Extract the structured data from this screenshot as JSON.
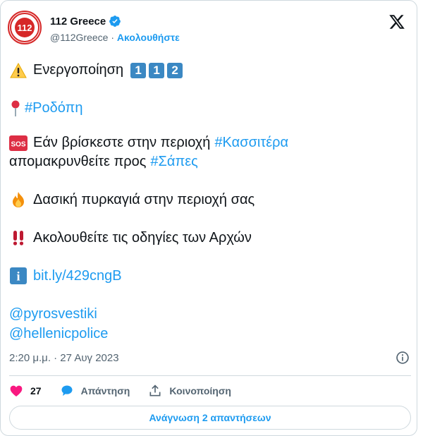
{
  "author": {
    "display_name": "112 Greece",
    "handle": "@112Greece",
    "separator": "·",
    "follow_label": "Ακολουθήστε",
    "avatar_text": "112"
  },
  "tweet": {
    "line1_text": "Ενεργοποίηση",
    "line1_keycaps": [
      "1",
      "1",
      "2"
    ],
    "line2_hashtag": "#Ροδόπη",
    "line3_text": "Εάν βρίσκεστε στην περιοχή",
    "line3_hashtag": "#Κασσιτέρα",
    "line4_text": "απομακρυνθείτε προς",
    "line4_hashtag": "#Σάπες",
    "line5_text": "Δασική πυρκαγιά στην περιοχή σας",
    "line6_text": "Ακολουθείτε τις οδηγίες των Αρχών",
    "line7_link": "bit.ly/429cngB",
    "mention1": "@pyrosvestiki",
    "mention2": "@hellenicpolice",
    "sos_label": "SOS",
    "info_label": "i"
  },
  "meta": {
    "timestamp": "2:20 μ.μ. · 27 Αυγ 2023"
  },
  "actions": {
    "like_count": "27",
    "reply_label": "Απάντηση",
    "share_label": "Κοινοποίηση"
  },
  "read_replies_label": "Ανάγνωση 2 απαντήσεων",
  "colors": {
    "accent": "#1d9bf0",
    "like": "#f91880",
    "text": "#0f1419",
    "muted": "#536471"
  }
}
